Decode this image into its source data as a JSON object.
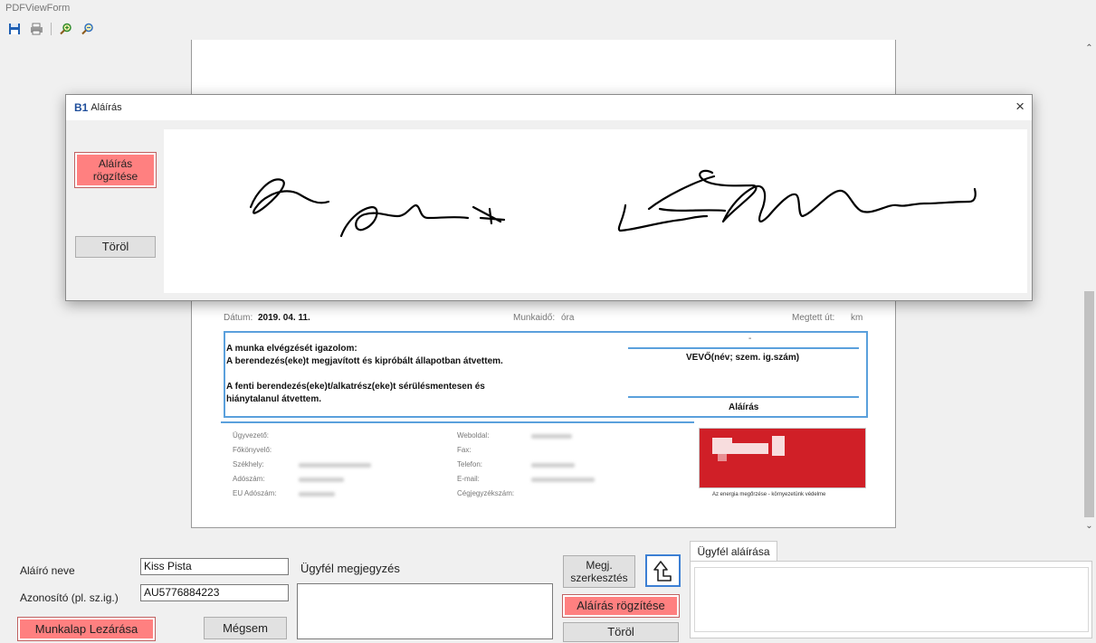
{
  "window": {
    "title": "PDFViewForm"
  },
  "toolbar": {
    "icons": [
      "save-icon",
      "print-icon",
      "zoom-in-icon",
      "zoom-out-icon"
    ]
  },
  "pdf": {
    "date_label": "Dátum:",
    "date_value": "2019. 04. 11.",
    "worktime_label": "Munkaidő:",
    "worktime_unit": "óra",
    "distance_label": "Megtett út:",
    "distance_unit": "km",
    "confirm_line1": "A munka elvégzését igazolom:",
    "confirm_line2": "A berendezés(eke)t megjavított és kipróbált állapotban átvettem.",
    "confirm_line3": "A fenti berendezés(eke)t/alkatrész(eke)t sérülésmentesen és",
    "confirm_line4": "hiánytalanul átvettem.",
    "dash": "-",
    "buyer_label": "VEVŐ(név; szem. ig.szám)",
    "signature_label": "Aláírás",
    "footer_left": [
      "Ügyvezető:",
      "Főkönyvelő:",
      "Székhely:",
      "Adószám:",
      "EU Adószám:"
    ],
    "footer_right": [
      "Weboldal:",
      "Fax:",
      "Telefon:",
      "E-mail:",
      "Cégjegyzékszám:"
    ],
    "logo_tagline": "Az energia megőrzése - környezetünk védelme"
  },
  "dialog": {
    "logo": "B1",
    "title": "Aláírás",
    "close": "×",
    "record_button": "Aláírás rögzítése",
    "clear_button": "Töröl"
  },
  "form": {
    "signer_label": "Aláíró neve",
    "signer_value": "Kiss Pista",
    "id_label": "Azonosító (pl. sz.ig.)",
    "id_value": "AU5776884223",
    "close_button": "Munkalap Lezárása",
    "cancel_button": "Mégsem",
    "comment_label": "Ügyfél megjegyzés",
    "comment_value": "",
    "edit_comment_button": "Megj. szerkesztés",
    "record_button": "Aláírás rögzítése",
    "clear_button": "Töröl",
    "signature_tab": "Ügyfél aláírása"
  },
  "colors": {
    "accent_red": "#ff8080",
    "accent_blue": "#5aa0dc",
    "logo_red": "#d01f27"
  }
}
